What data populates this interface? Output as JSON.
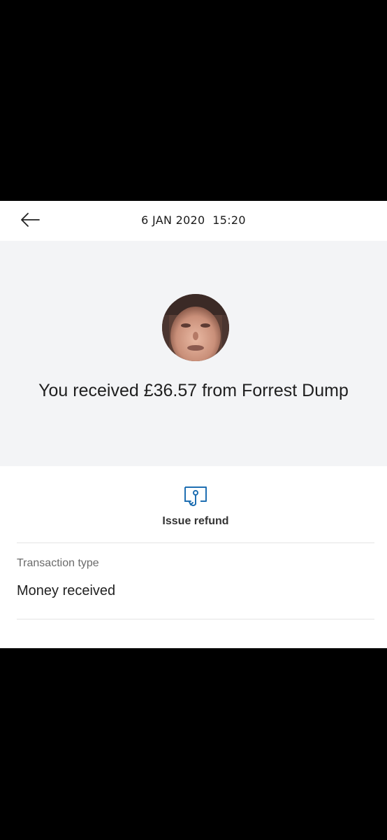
{
  "header": {
    "date": "6 JAN 2020  15:20",
    "back_icon": "arrow-left-icon"
  },
  "transaction": {
    "summary": "You received £36.57 from Forrest Dump",
    "avatar": "profile-photo"
  },
  "actions": {
    "refund_label": "Issue refund",
    "refund_icon": "refund-icon",
    "accent": "#1f6fb2"
  },
  "details": {
    "type_label": "Transaction type",
    "type_value": "Money received"
  }
}
